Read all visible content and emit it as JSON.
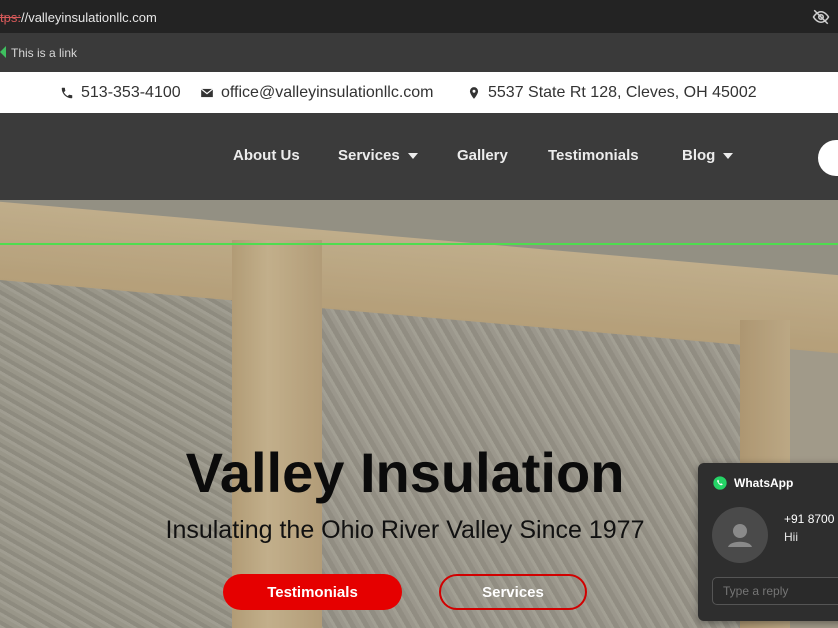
{
  "browser": {
    "url_scheme": "tps:",
    "url_rest": "//valleyinsulationllc.com",
    "eye_icon": "eye-off-icon"
  },
  "link_hint": {
    "text": "This is a link"
  },
  "contact": {
    "phone": "513-353-4100",
    "email": "office@valleyinsulationllc.com",
    "address": "5537 State Rt 128, Cleves, OH 45002"
  },
  "nav": {
    "items": [
      {
        "label": "About Us",
        "dropdown": false
      },
      {
        "label": "Services",
        "dropdown": true
      },
      {
        "label": "Gallery",
        "dropdown": false
      },
      {
        "label": "Testimonials",
        "dropdown": false
      },
      {
        "label": "Blog",
        "dropdown": true
      }
    ]
  },
  "hero": {
    "title": "Valley Insulation",
    "subtitle": "Insulating the Ohio River Valley Since 1977",
    "buttons": {
      "primary": "Testimonials",
      "secondary": "Services"
    }
  },
  "whatsapp": {
    "title": "WhatsApp",
    "number": "+91 8700",
    "message": "Hii",
    "reply_placeholder": "Type a reply"
  },
  "colors": {
    "accent_red": "#e50000",
    "nav_bg": "#3b3b3b",
    "whatsapp_green": "#25d366"
  }
}
